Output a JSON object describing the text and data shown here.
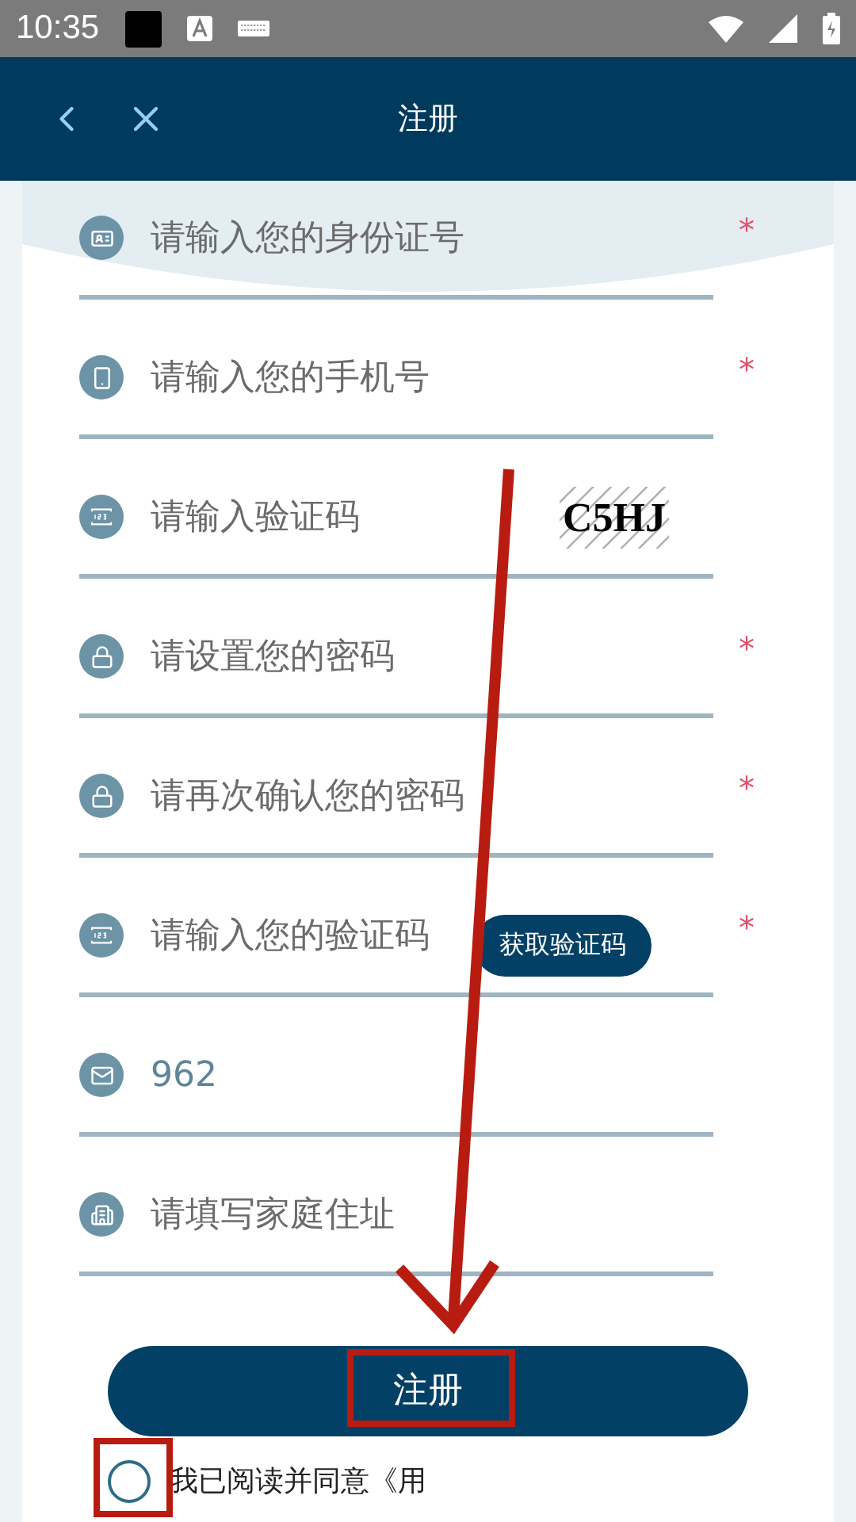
{
  "status_bar": {
    "time": "10:35"
  },
  "header": {
    "title": "注册"
  },
  "fields": [
    {
      "kind": "id_card",
      "placeholder": "请输入您的身份证号",
      "required_mark": "*"
    },
    {
      "kind": "phone",
      "placeholder": "请输入您的手机号",
      "required_mark": "*"
    },
    {
      "kind": "captcha",
      "placeholder": "请输入验证码",
      "captcha": "C5HJ"
    },
    {
      "kind": "password",
      "placeholder": "请设置您的密码",
      "required_mark": "*"
    },
    {
      "kind": "password",
      "placeholder": "请再次确认您的密码",
      "required_mark": "*"
    },
    {
      "kind": "sms_code",
      "placeholder": "请输入您的验证码",
      "required_mark": "*",
      "button": "获取验证码"
    },
    {
      "kind": "email",
      "value": "962"
    },
    {
      "kind": "address",
      "placeholder": "请填写家庭住址"
    }
  ],
  "submit": {
    "label": "注册"
  },
  "agreement": {
    "checked": false,
    "text": "我已阅读并同意《用"
  }
}
